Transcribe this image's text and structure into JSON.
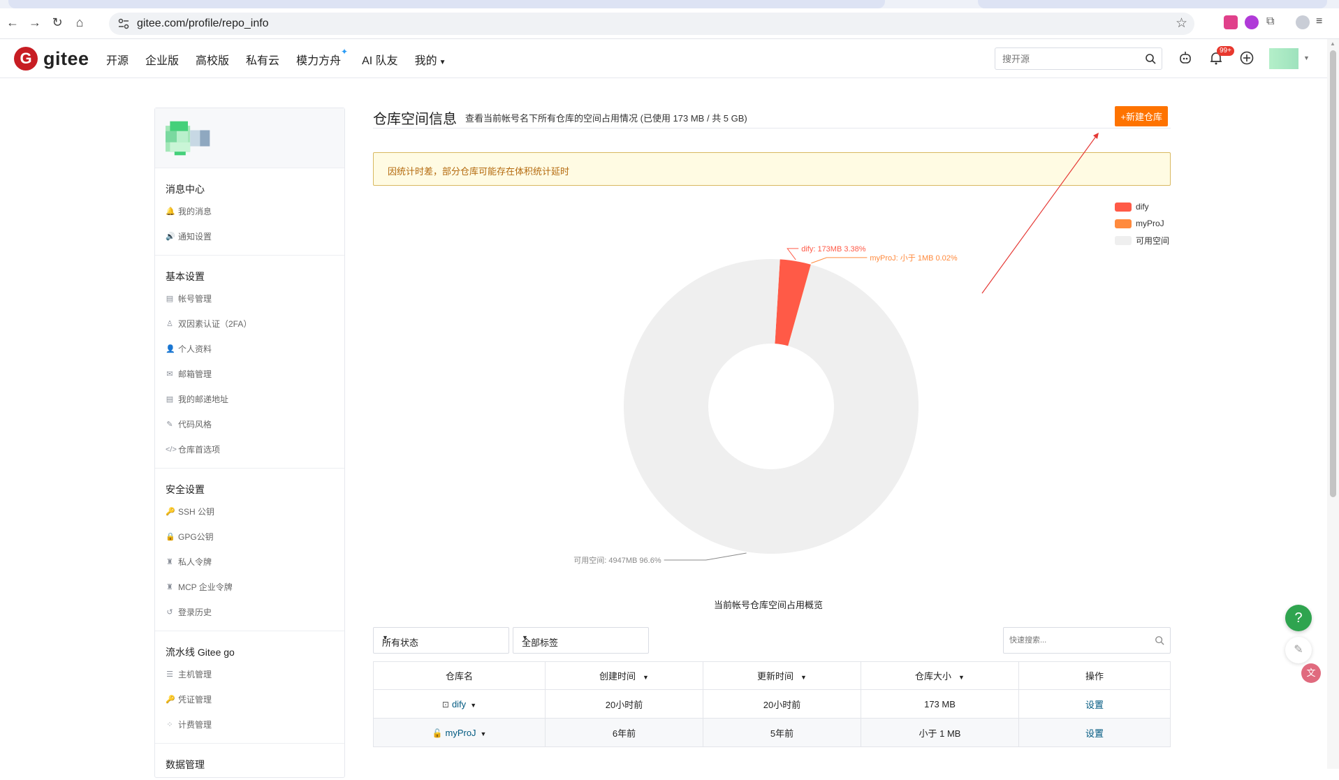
{
  "browser": {
    "url": "gitee.com/profile/repo_info"
  },
  "header": {
    "logo_text": "gitee",
    "nav": [
      "开源",
      "企业版",
      "高校版",
      "私有云",
      "模力方舟",
      "AI 队友",
      "我的"
    ],
    "search_placeholder": "搜开源",
    "notification_badge": "99+"
  },
  "sidebar": {
    "groups": [
      {
        "title": "消息中心",
        "items": [
          {
            "label": "我的消息",
            "icon": "bell-icon",
            "glyph": "🔔"
          },
          {
            "label": "通知设置",
            "icon": "speaker-icon",
            "glyph": "🔊"
          }
        ]
      },
      {
        "title": "基本设置",
        "items": [
          {
            "label": "帐号管理",
            "icon": "id-card-icon",
            "glyph": "▤"
          },
          {
            "label": "双因素认证（2FA）",
            "icon": "user-shield-icon",
            "glyph": "♙"
          },
          {
            "label": "个人资料",
            "icon": "user-icon",
            "glyph": "👤"
          },
          {
            "label": "邮箱管理",
            "icon": "mail-icon",
            "glyph": "✉"
          },
          {
            "label": "我的邮递地址",
            "icon": "address-card-icon",
            "glyph": "▤"
          },
          {
            "label": "代码风格",
            "icon": "brush-icon",
            "glyph": "✎"
          },
          {
            "label": "仓库首选项",
            "icon": "code-icon",
            "glyph": "</>"
          }
        ]
      },
      {
        "title": "安全设置",
        "items": [
          {
            "label": "SSH 公钥",
            "icon": "key-icon",
            "glyph": "🔑"
          },
          {
            "label": "GPG公钥",
            "icon": "lock-icon",
            "glyph": "🔒"
          },
          {
            "label": "私人令牌",
            "icon": "token-icon",
            "glyph": "♜"
          },
          {
            "label": "MCP 企业令牌",
            "icon": "token-icon",
            "glyph": "♜"
          },
          {
            "label": "登录历史",
            "icon": "history-icon",
            "glyph": "↺"
          }
        ]
      },
      {
        "title": "流水线 Gitee go",
        "items": [
          {
            "label": "主机管理",
            "icon": "server-icon",
            "glyph": "☰"
          },
          {
            "label": "凭证管理",
            "icon": "key-icon",
            "glyph": "🔑"
          },
          {
            "label": "计费管理",
            "icon": "billing-icon",
            "glyph": "⁘"
          }
        ]
      },
      {
        "title": "数据管理",
        "items": []
      }
    ]
  },
  "main": {
    "title": "仓库空间信息",
    "subtitle": "查看当前帐号名下所有仓库的空间占用情况 (已使用 173 MB / 共 5 GB)",
    "new_repo_button": "+新建仓库",
    "notice": "因统计时差，部分仓库可能存在体积统计延时",
    "chart_caption": "当前帐号仓库空间占用概览",
    "filters": {
      "status": "所有状态",
      "tags": "全部标签",
      "search_placeholder": "快速搜索..."
    },
    "table": {
      "headers": [
        "仓库名",
        "创建时间",
        "更新时间",
        "仓库大小",
        "操作"
      ],
      "rows": [
        {
          "name": "dify",
          "created": "20小时前",
          "updated": "20小时前",
          "size": "173 MB",
          "action": "设置",
          "visibility_icon": "public-repo-icon"
        },
        {
          "name": "myProJ",
          "created": "6年前",
          "updated": "5年前",
          "size": "小于 1 MB",
          "action": "设置",
          "visibility_icon": "private-lock-icon"
        }
      ]
    }
  },
  "chart_data": {
    "type": "pie",
    "title": "",
    "caption": "当前帐号仓库空间占用概览",
    "unit": "MB",
    "legend_position": "top-right",
    "slices": [
      {
        "name": "dify",
        "value": 173,
        "percent": 3.38,
        "color": "#ff5a47",
        "label": "dify: 173MB 3.38%"
      },
      {
        "name": "myProJ",
        "value": 1,
        "percent": 0.02,
        "color": "#ff8a3d",
        "label": "myProJ: 小于 1MB 0.02%"
      },
      {
        "name": "可用空间",
        "value": 4947,
        "percent": 96.6,
        "color": "#efefef",
        "label": "可用空间: 4947MB 96.6%"
      }
    ]
  }
}
